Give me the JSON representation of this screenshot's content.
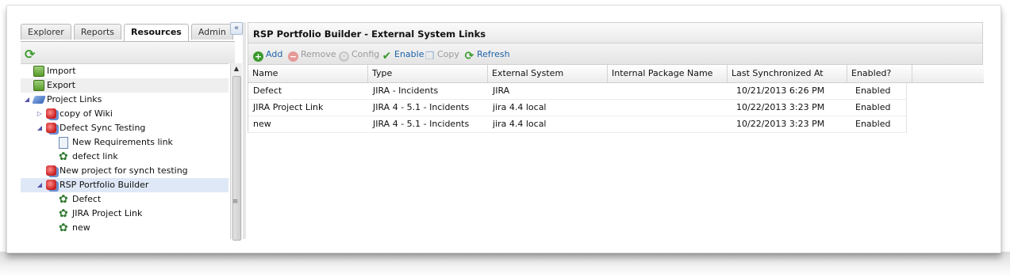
{
  "left_panel": {
    "tabs": [
      {
        "label": "Explorer",
        "active": false
      },
      {
        "label": "Reports",
        "active": false
      },
      {
        "label": "Resources",
        "active": true
      },
      {
        "label": "Admin",
        "active": false
      }
    ],
    "collapse_glyph": "«",
    "tree": [
      {
        "label": "Import",
        "icon": "import-icon",
        "state": ""
      },
      {
        "label": "Export",
        "icon": "export-icon",
        "state": "hovered"
      },
      {
        "label": "Project Links",
        "icon": "project-links-icon",
        "state": ""
      },
      {
        "label": "copy of Wiki",
        "icon": "project-icon",
        "state": ""
      },
      {
        "label": "Defect Sync Testing",
        "icon": "project-icon",
        "state": ""
      },
      {
        "label": "New Requirements link",
        "icon": "requirements-link-icon",
        "state": ""
      },
      {
        "label": "defect link",
        "icon": "link-icon",
        "state": ""
      },
      {
        "label": "New project for synch testing",
        "icon": "project-icon",
        "state": ""
      },
      {
        "label": "RSP Portfolio Builder",
        "icon": "project-icon",
        "state": "selected"
      },
      {
        "label": "Defect",
        "icon": "link-icon",
        "state": ""
      },
      {
        "label": "JIRA Project Link",
        "icon": "link-icon",
        "state": ""
      },
      {
        "label": "new",
        "icon": "link-icon",
        "state": ""
      }
    ]
  },
  "right_panel": {
    "title": "RSP Portfolio Builder - External System Links",
    "toolbar": {
      "add": "Add",
      "remove": "Remove",
      "config": "Config",
      "enable": "Enable",
      "copy": "Copy",
      "refresh": "Refresh"
    },
    "columns": [
      "Name",
      "Type",
      "External System",
      "Internal Package Name",
      "Last Synchronized At",
      "Enabled?"
    ],
    "rows": [
      [
        "Defect",
        "JIRA - Incidents",
        "JIRA",
        "",
        "10/21/2013 6:26 PM",
        "Enabled"
      ],
      [
        "JIRA Project Link",
        "JIRA 4 - 5.1 - Incidents",
        "jira 4.4 local",
        "",
        "10/22/2013 3:23 PM",
        "Enabled"
      ],
      [
        "new",
        "JIRA 4 - 5.1 - Incidents",
        "jira 4.4 local",
        "",
        "10/22/2013 3:23 PM",
        "Enabled"
      ]
    ]
  },
  "colors": {
    "selection": "#dfe8f6",
    "link_blue": "#1e63a8",
    "add_green": "#3a9a2c",
    "remove_red": "#d9534f"
  }
}
